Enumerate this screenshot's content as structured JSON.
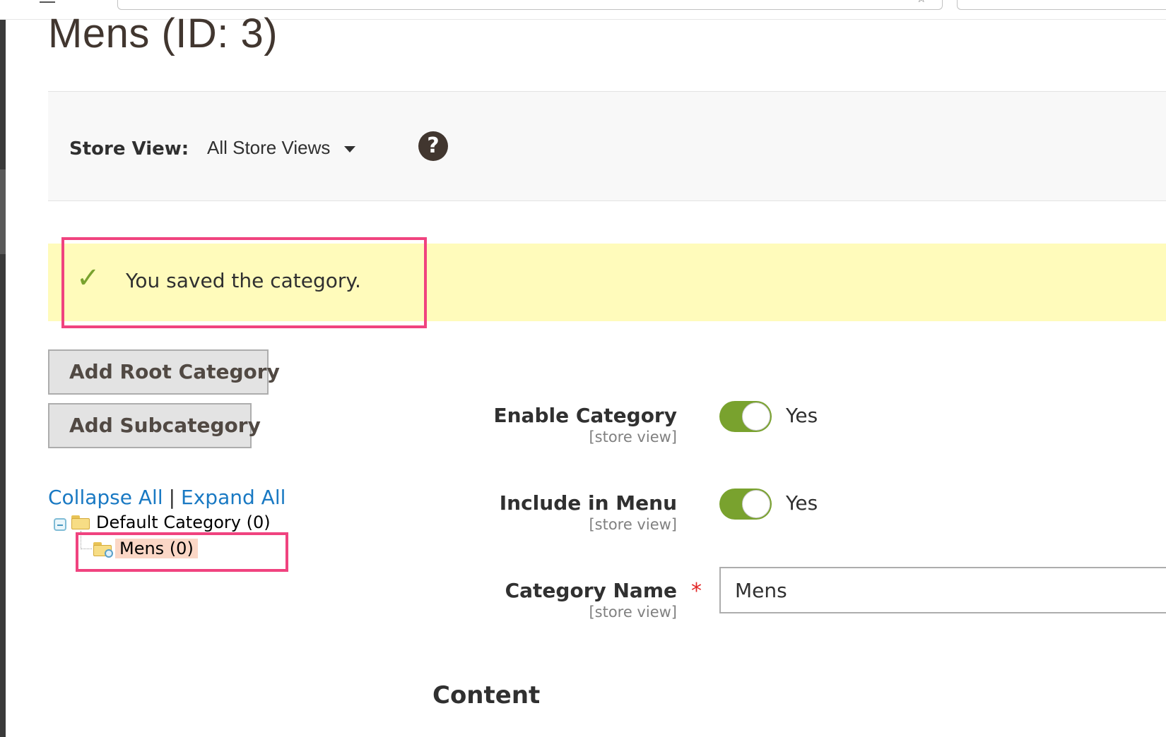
{
  "page": {
    "title": "Mens (ID: 3)"
  },
  "store_view": {
    "label": "Store View:",
    "selected": "All Store Views",
    "help_icon": "question-circle-icon"
  },
  "message": {
    "text": "You saved the category.",
    "icon": "check-icon"
  },
  "buttons": {
    "add_root": "Add Root Category",
    "add_sub": "Add Subcategory"
  },
  "tree": {
    "collapse_all": "Collapse All",
    "separator": "|",
    "expand_all": "Expand All",
    "nodes": [
      {
        "label": "Default Category (0)",
        "expanded": true
      },
      {
        "label": "Mens (0)",
        "selected": true
      }
    ]
  },
  "form": {
    "enable": {
      "label": "Enable Category",
      "scope": "[store view]",
      "value": "Yes",
      "checked": true
    },
    "menu": {
      "label": "Include in Menu",
      "scope": "[store view]",
      "value": "Yes",
      "checked": true
    },
    "name": {
      "label": "Category Name",
      "scope": "[store view]",
      "required_mark": "*",
      "value": "Mens"
    }
  },
  "sections": {
    "content": "Content"
  },
  "colors": {
    "accent_green": "#79a22e",
    "link_blue": "#1979c3",
    "highlight_pink": "#f0437f",
    "message_bg": "#fffbbb",
    "required_red": "#e22626"
  }
}
